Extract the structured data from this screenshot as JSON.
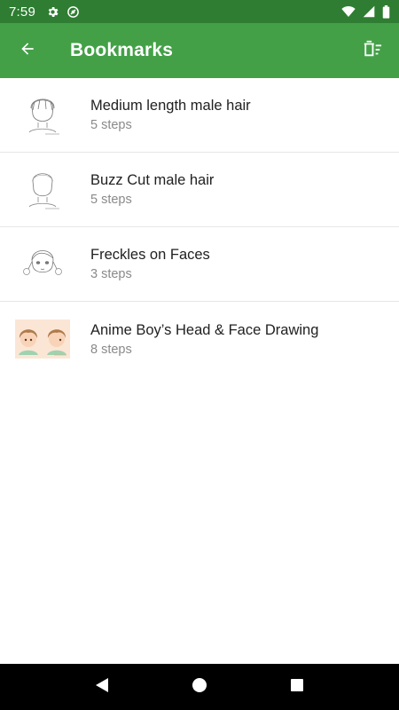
{
  "status_bar": {
    "time": "7:59",
    "left_icons": [
      "gear-icon",
      "sync-icon"
    ],
    "right_icons": [
      "wifi-icon",
      "signal-icon",
      "battery-icon"
    ],
    "background": "#2e7d32"
  },
  "app_bar": {
    "title": "Bookmarks",
    "back_icon": "arrow-back-icon",
    "action_icon": "delete-sweep-icon",
    "background": "#43a047"
  },
  "bookmarks": [
    {
      "title": "Medium length male hair",
      "steps": "5 steps",
      "thumbnail": "male-hair-sketch"
    },
    {
      "title": "Buzz Cut male hair",
      "steps": "5 steps",
      "thumbnail": "buzz-cut-sketch"
    },
    {
      "title": "Freckles on Faces",
      "steps": "3 steps",
      "thumbnail": "girl-face-sketch"
    },
    {
      "title": "Anime Boy’s Head & Face Drawing",
      "steps": "8 steps",
      "thumbnail": "anime-boy-color"
    }
  ],
  "nav_bar": {
    "buttons": [
      "back-triangle-icon",
      "home-circle-icon",
      "recents-square-icon"
    ]
  }
}
